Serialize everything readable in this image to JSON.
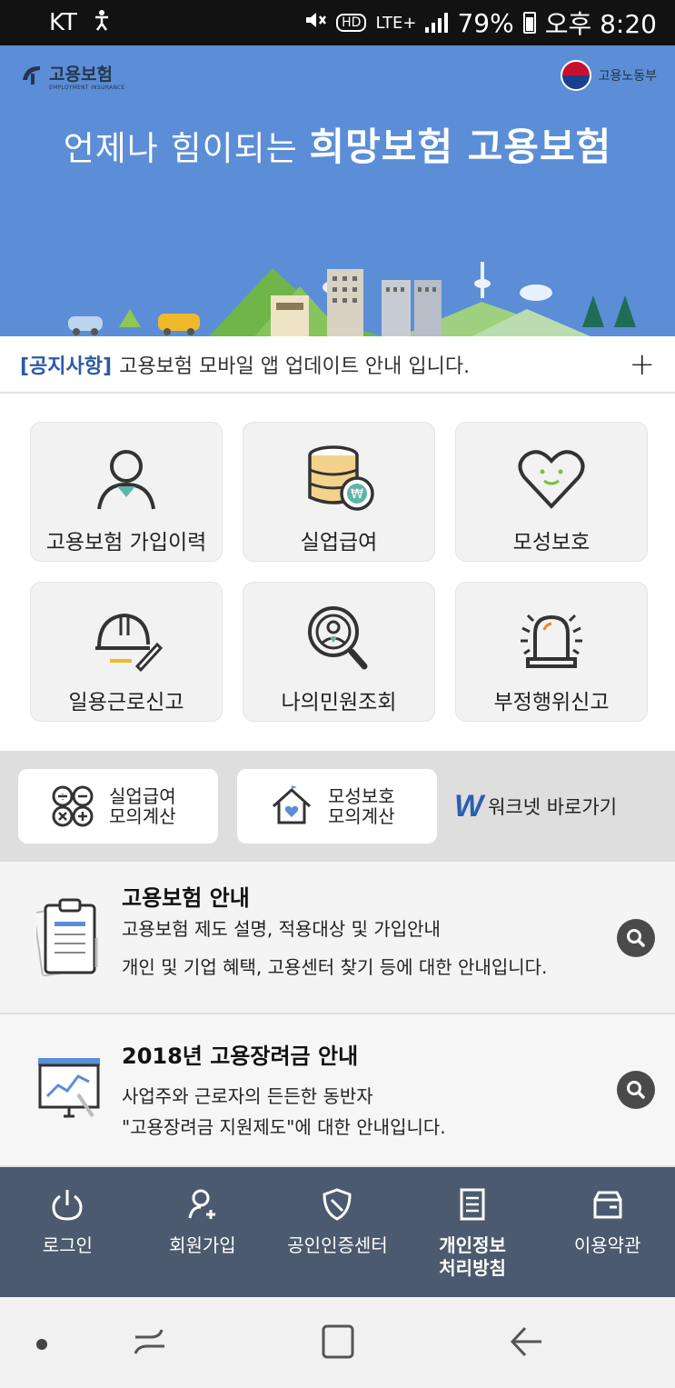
{
  "status_bar": {
    "carrier": "KT",
    "network": "LTE+",
    "hd": "HD",
    "battery": "79%",
    "time": "오후 8:20"
  },
  "banner": {
    "brand_name": "고용보험",
    "brand_sub": "EMPLOYMENT INSURANCE",
    "ministry": "고용노동부",
    "headline_light": "언제나 힘이되는 ",
    "headline_bold": "희망보험 고용보험"
  },
  "notice": {
    "tag": "[공지사항]",
    "text": "고용보험 모바일 앱 업데이트 안내 입니다.",
    "more": "+"
  },
  "tiles": [
    {
      "label": "고용보험 가입이력",
      "icon": "person-icon"
    },
    {
      "label": "실업급여",
      "icon": "coin-stack-won-icon"
    },
    {
      "label": "모성보호",
      "icon": "heart-smile-icon"
    },
    {
      "label": "일용근로신고",
      "icon": "hardhat-pencil-icon"
    },
    {
      "label": "나의민원조회",
      "icon": "person-magnifier-icon"
    },
    {
      "label": "부정행위신고",
      "icon": "siren-icon"
    }
  ],
  "calculators": [
    {
      "line1": "실업급여",
      "line2": "모의계산",
      "icon": "calculator-icon"
    },
    {
      "line1": "모성보호",
      "line2": "모의계산",
      "icon": "house-heart-icon"
    }
  ],
  "worknet": {
    "mark": "W",
    "label": "워크넷 바로가기"
  },
  "info_cards": [
    {
      "title": "고용보험 안내",
      "line1": "고용보험 제도 설명, 적용대상 및 가입안내",
      "line2": "개인 및 기업 혜택, 고용센터 찾기 등에 대한 안내입니다.",
      "icon": "clipboard-icon"
    },
    {
      "title": "2018년 고용장려금 안내",
      "line1": "사업주와 근로자의 든든한 동반자",
      "line2": "\"고용장려금 지원제도\"에 대한 안내입니다.",
      "icon": "chart-board-icon"
    }
  ],
  "bottom_nav": [
    {
      "label": "로그인",
      "icon": "power-icon",
      "bold": false
    },
    {
      "label": "회원가입",
      "icon": "add-user-icon",
      "bold": false
    },
    {
      "label": "공인인증센터",
      "icon": "shield-icon",
      "bold": false
    },
    {
      "label": "개인정보\n처리방침",
      "icon": "document-icon",
      "bold": true
    },
    {
      "label": "이용약관",
      "icon": "wallet-icon",
      "bold": false
    }
  ],
  "colors": {
    "banner": "#5b8ed6",
    "notice_tag": "#2a5ba8",
    "bottom_nav": "#4b5a6e",
    "calc_strip": "#dedede"
  }
}
